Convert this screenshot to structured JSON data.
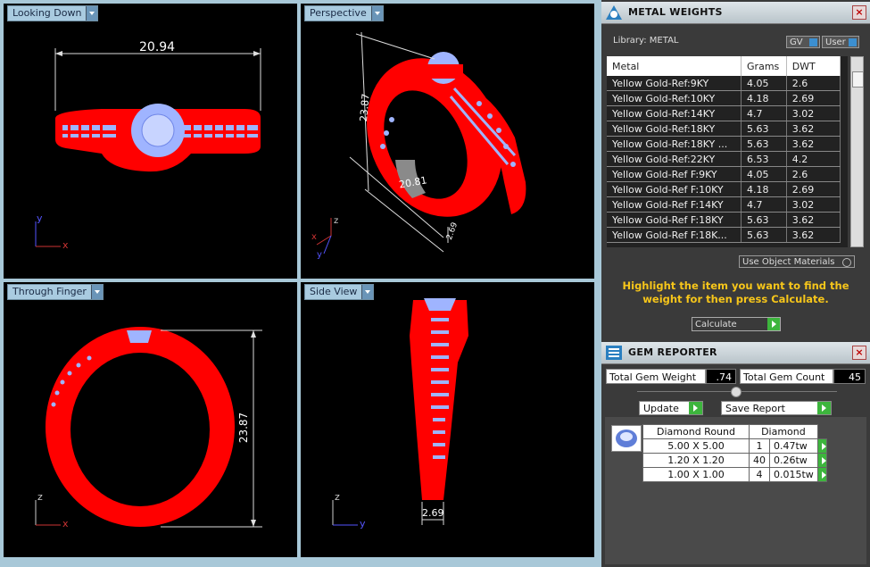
{
  "viewports": {
    "looking_down": {
      "label": "Looking Down",
      "dimension": "20.94",
      "axis_up": "y",
      "axis_right": "x"
    },
    "perspective": {
      "label": "Perspective",
      "dim_height": "23.87",
      "dim_width": "20.81",
      "dim_depth": "2.69",
      "axis_up": "z",
      "axis_left": "x",
      "axis_down": "y"
    },
    "through_finger": {
      "label": "Through Finger",
      "dimension": "23.87",
      "axis_up": "z",
      "axis_right": "x"
    },
    "side_view": {
      "label": "Side View",
      "dimension": "2.69",
      "axis_up": "z",
      "axis_right": "y"
    }
  },
  "metal_weights": {
    "title": "METAL WEIGHTS",
    "library_label": "Library: METAL",
    "gv_label": "GV",
    "user_label": "User",
    "columns": [
      "Metal",
      "Grams",
      "DWT"
    ],
    "rows": [
      [
        "Yellow Gold-Ref:9KY",
        "4.05",
        "2.6"
      ],
      [
        "Yellow Gold-Ref:10KY",
        "4.18",
        "2.69"
      ],
      [
        "Yellow Gold-Ref:14KY",
        "4.7",
        "3.02"
      ],
      [
        "Yellow Gold-Ref:18KY",
        "5.63",
        "3.62"
      ],
      [
        "Yellow Gold-Ref:18KY ...",
        "5.63",
        "3.62"
      ],
      [
        "Yellow Gold-Ref:22KY",
        "6.53",
        "4.2"
      ],
      [
        "Yellow Gold-Ref F:9KY",
        "4.05",
        "2.6"
      ],
      [
        "Yellow Gold-Ref F:10KY",
        "4.18",
        "2.69"
      ],
      [
        "Yellow Gold-Ref F:14KY",
        "4.7",
        "3.02"
      ],
      [
        "Yellow Gold-Ref F:18KY",
        "5.63",
        "3.62"
      ],
      [
        "Yellow Gold-Ref F:18K...",
        "5.63",
        "3.62"
      ]
    ],
    "use_object_materials": "Use Object Materials",
    "hint": "Highlight the item you want to find the weight for then press Calculate.",
    "calculate_label": "Calculate"
  },
  "gem_reporter": {
    "title": "GEM REPORTER",
    "total_weight_label": "Total Gem Weight",
    "total_weight_value": ".74",
    "total_count_label": "Total Gem Count",
    "total_count_value": "45",
    "update_label": "Update",
    "save_report_label": "Save Report",
    "table_header": [
      "Diamond Round",
      "Diamond"
    ],
    "rows": [
      [
        "5.00 X 5.00",
        "1",
        "0.47tw"
      ],
      [
        "1.20 X 1.20",
        "40",
        "0.26tw"
      ],
      [
        "1.00 X 1.00",
        "4",
        "0.015tw"
      ]
    ]
  },
  "colors": {
    "metal": "#ff0000",
    "gem": "#9fb4ff",
    "accent": "#3db53d",
    "hint": "#f7c61a"
  }
}
